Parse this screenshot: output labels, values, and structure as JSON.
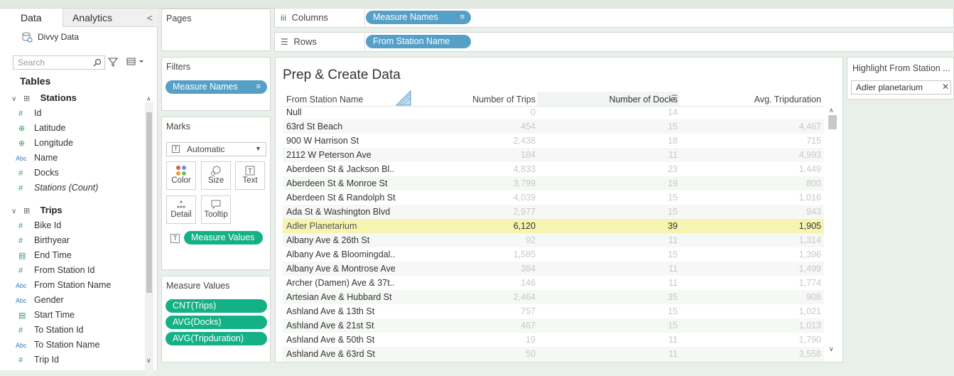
{
  "datapane": {
    "tab_data": "Data",
    "tab_analytics": "Analytics",
    "collapse_glyph": "<",
    "datasource": "Divvy Data",
    "search_placeholder": "Search",
    "tables_label": "Tables",
    "stations_label": "Stations",
    "stations_fields": [
      {
        "name": "Id",
        "icon": "#"
      },
      {
        "name": "Latitude",
        "icon": "globe"
      },
      {
        "name": "Longitude",
        "icon": "globe"
      },
      {
        "name": "Name",
        "icon": "Abc"
      },
      {
        "name": "Docks",
        "icon": "#"
      },
      {
        "name": "Stations (Count)",
        "icon": "#"
      }
    ],
    "trips_label": "Trips",
    "trips_fields": [
      {
        "name": "Bike Id",
        "icon": "#"
      },
      {
        "name": "Birthyear",
        "icon": "#"
      },
      {
        "name": "End Time",
        "icon": "date"
      },
      {
        "name": "From Station Id",
        "icon": "#"
      },
      {
        "name": "From Station Name",
        "icon": "Abc"
      },
      {
        "name": "Gender",
        "icon": "Abc"
      },
      {
        "name": "Start Time",
        "icon": "date"
      },
      {
        "name": "To Station Id",
        "icon": "#"
      },
      {
        "name": "To Station Name",
        "icon": "Abc"
      },
      {
        "name": "Trip Id",
        "icon": "#"
      }
    ]
  },
  "cards": {
    "pages_title": "Pages",
    "filters_title": "Filters",
    "filter_pill": "Measure Names",
    "marks_title": "Marks",
    "marks_type": "Automatic",
    "mark_buttons": [
      "Color",
      "Size",
      "Text",
      "Detail",
      "Tooltip"
    ],
    "marks_pill": "Measure Values",
    "measure_values_title": "Measure Values",
    "measure_pills": [
      "CNT(Trips)",
      "AVG(Docks)",
      "AVG(Tripduration)"
    ]
  },
  "shelves": {
    "columns_label": "Columns",
    "columns_pill": "Measure Names",
    "rows_label": "Rows",
    "rows_pill": "From Station Name"
  },
  "viz": {
    "title": "Prep & Create Data",
    "headers": [
      "From Station Name",
      "Number of Trips",
      "Number of Docks",
      "Avg. Tripduration"
    ],
    "rows": [
      [
        "Null",
        "0",
        "14",
        ""
      ],
      [
        "63rd St Beach",
        "454",
        "15",
        "4,467"
      ],
      [
        "900 W Harrison St",
        "2,438",
        "18",
        "715"
      ],
      [
        "2112 W Peterson Ave",
        "184",
        "11",
        "4,993"
      ],
      [
        "Aberdeen St & Jackson Bl..",
        "4,833",
        "23",
        "1,449"
      ],
      [
        "Aberdeen St & Monroe St",
        "3,799",
        "19",
        "800"
      ],
      [
        "Aberdeen St & Randolph St",
        "4,039",
        "15",
        "1,016"
      ],
      [
        "Ada St & Washington Blvd",
        "2,977",
        "15",
        "943"
      ],
      [
        "Adler Planetarium",
        "6,120",
        "39",
        "1,905"
      ],
      [
        "Albany Ave & 26th St",
        "92",
        "11",
        "1,314"
      ],
      [
        "Albany Ave & Bloomingdal..",
        "1,585",
        "15",
        "1,396"
      ],
      [
        "Albany Ave & Montrose Ave",
        "384",
        "11",
        "1,499"
      ],
      [
        "Archer (Damen) Ave & 37t..",
        "146",
        "11",
        "1,774"
      ],
      [
        "Artesian Ave & Hubbard St",
        "2,464",
        "35",
        "908"
      ],
      [
        "Ashland Ave & 13th St",
        "757",
        "15",
        "1,021"
      ],
      [
        "Ashland Ave & 21st St",
        "467",
        "15",
        "1,013"
      ],
      [
        "Ashland Ave & 50th St",
        "19",
        "11",
        "1,790"
      ],
      [
        "Ashland Ave & 63rd St",
        "50",
        "11",
        "3,558"
      ]
    ],
    "highlighted_row": 8
  },
  "highlighter": {
    "title": "Highlight From Station ...",
    "value": "Adler planetarium"
  },
  "colors": {
    "blue_pill": "#56a0c7",
    "green_pill": "#14b187",
    "highlight": "#f6f4b0"
  }
}
